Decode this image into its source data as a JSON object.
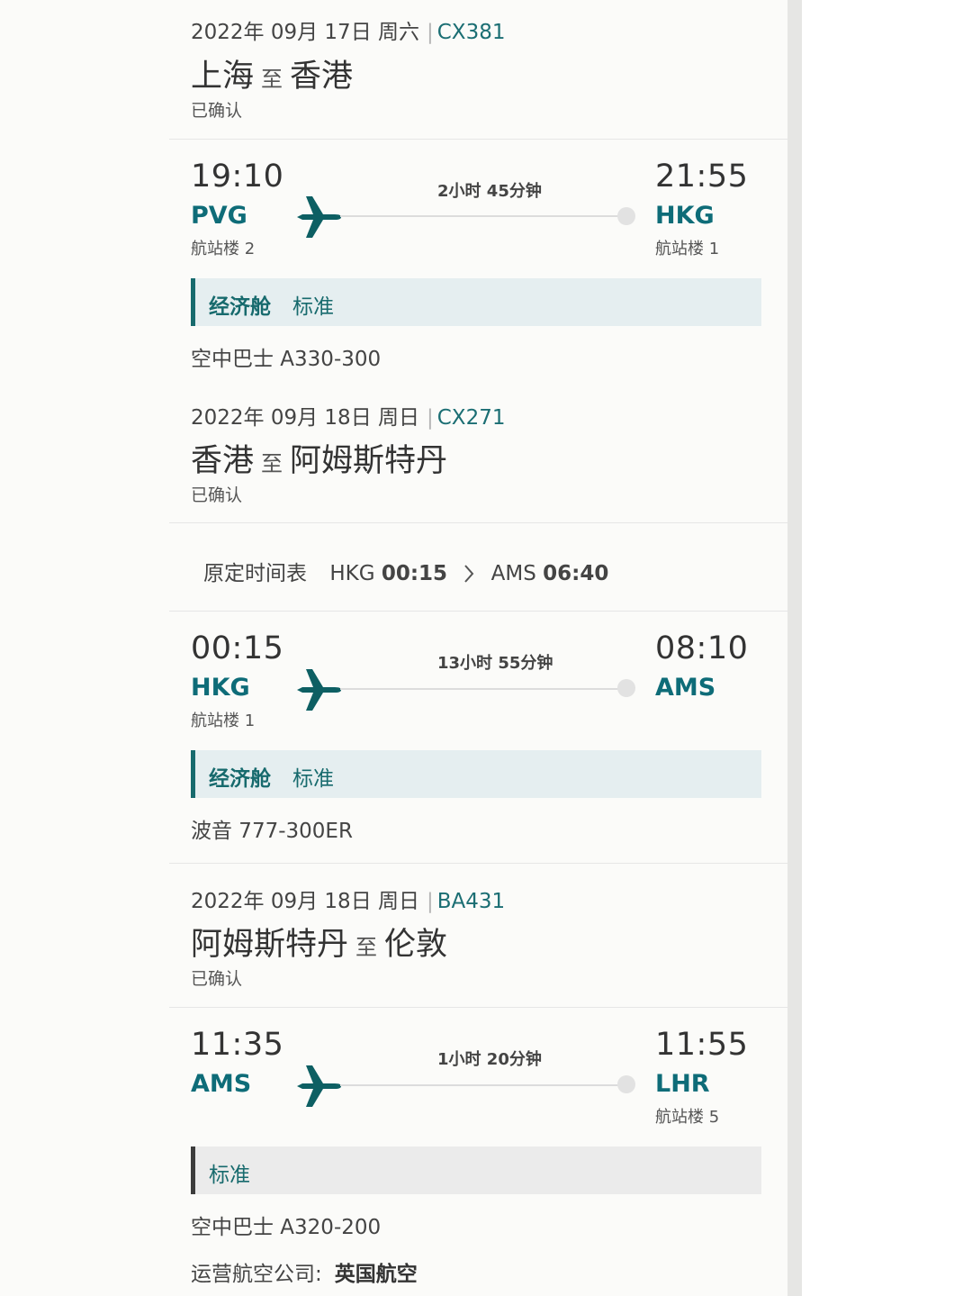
{
  "segments": [
    {
      "date": "2022年 09月 17日 周六",
      "flight": "CX381",
      "origin_city": "上海",
      "to": "至",
      "dest_city": "香港",
      "status": "已确认",
      "dep_time": "19:10",
      "dep_code": "PVG",
      "dep_terminal": "航站楼 2",
      "duration": "2小时 45分钟",
      "arr_time": "21:55",
      "arr_code": "HKG",
      "arr_terminal": "航站楼 1",
      "cabin_class": "经济舱",
      "fare_type": "标准",
      "aircraft": "空中巴士 A330-300"
    },
    {
      "date": "2022年 09月 18日 周日",
      "flight": "CX271",
      "origin_city": "香港",
      "to": "至",
      "dest_city": "阿姆斯特丹",
      "status": "已确认",
      "original_schedule": {
        "label": "原定时间表",
        "from_code": "HKG",
        "from_time": "00:15",
        "to_code": "AMS",
        "to_time": "06:40"
      },
      "dep_time": "00:15",
      "dep_code": "HKG",
      "dep_terminal": "航站楼 1",
      "duration": "13小时 55分钟",
      "arr_time": "08:10",
      "arr_code": "AMS",
      "arr_terminal": "",
      "cabin_class": "经济舱",
      "fare_type": "标准",
      "aircraft": "波音 777-300ER"
    },
    {
      "date": "2022年 09月 18日 周日",
      "flight": "BA431",
      "origin_city": "阿姆斯特丹",
      "to": "至",
      "dest_city": "伦敦",
      "status": "已确认",
      "dep_time": "11:35",
      "dep_code": "AMS",
      "dep_terminal": "",
      "duration": "1小时 20分钟",
      "arr_time": "11:55",
      "arr_code": "LHR",
      "arr_terminal": "航站楼 5",
      "fare_type": "标准",
      "aircraft": "空中巴士 A320-200",
      "operator_label": "运营航空公司:",
      "operator_name": "英国航空"
    }
  ],
  "icons": {
    "plane": "airplane-icon",
    "arrival": "arrival-dot-icon",
    "chevron": "chevron-right-icon"
  },
  "colors": {
    "accent": "#0e6c78",
    "cabin_bg": "#e5eef0",
    "cabin_bar": "#176a6d"
  }
}
